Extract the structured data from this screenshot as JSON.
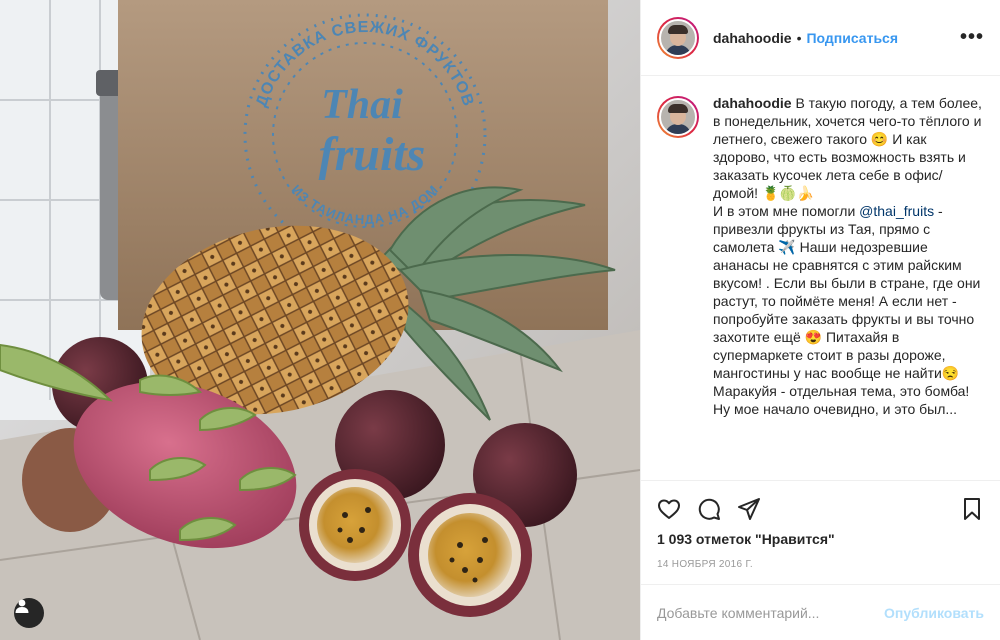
{
  "photo": {
    "bag_text_top": "ДОСТАВКА СВЕЖИХ ФРУКТОВ",
    "bag_text_bottom": "ИЗ ТАИЛАНДА НА ДОМ",
    "logo_line1": "Thai",
    "logo_line2": "fruits"
  },
  "header": {
    "username": "dahahoodie",
    "separator": "•",
    "follow_label": "Подписаться",
    "more_icon": "more-options-icon"
  },
  "caption": {
    "username": "dahahoodie",
    "text_part1": "В такую погоду, а тем более, в понедельник, хочется чего-то тёплого и летнего, свежего такого 😊 И как здорово, что есть возможность взять и заказать кусочек лета себе в офис/домой! 🍍🍈🍌",
    "text_part2": "И в этом мне помогли",
    "mention": "@thai_fruits",
    "text_part3": " - привезли фрукты из Тая, прямо с самолета ✈️ Наши недозревшие ананасы не сравнятся с этим райским вкусом! . Если вы были в стране, где они растут, то поймёте меня! А если нет - попробуйте заказать фрукты и вы точно захотите ещё 😍 Питахайя в супермаркете стоит в разы дороже, мангостины у нас вообще не найти😒 Маракуйя - отдельная тема, это бомба!",
    "text_part4": "Ну мое начало очевидно, и это был..."
  },
  "actions": {
    "likes": "1 093 отметок \"Нравится\"",
    "date": "14 НОЯБРЯ 2016 Г."
  },
  "comment_box": {
    "placeholder": "Добавьте комментарий...",
    "publish_label": "Опубликовать"
  },
  "colors": {
    "link": "#3897f0",
    "publish_disabled": "#b2dffc",
    "border": "#efefef",
    "muted": "#999999"
  }
}
